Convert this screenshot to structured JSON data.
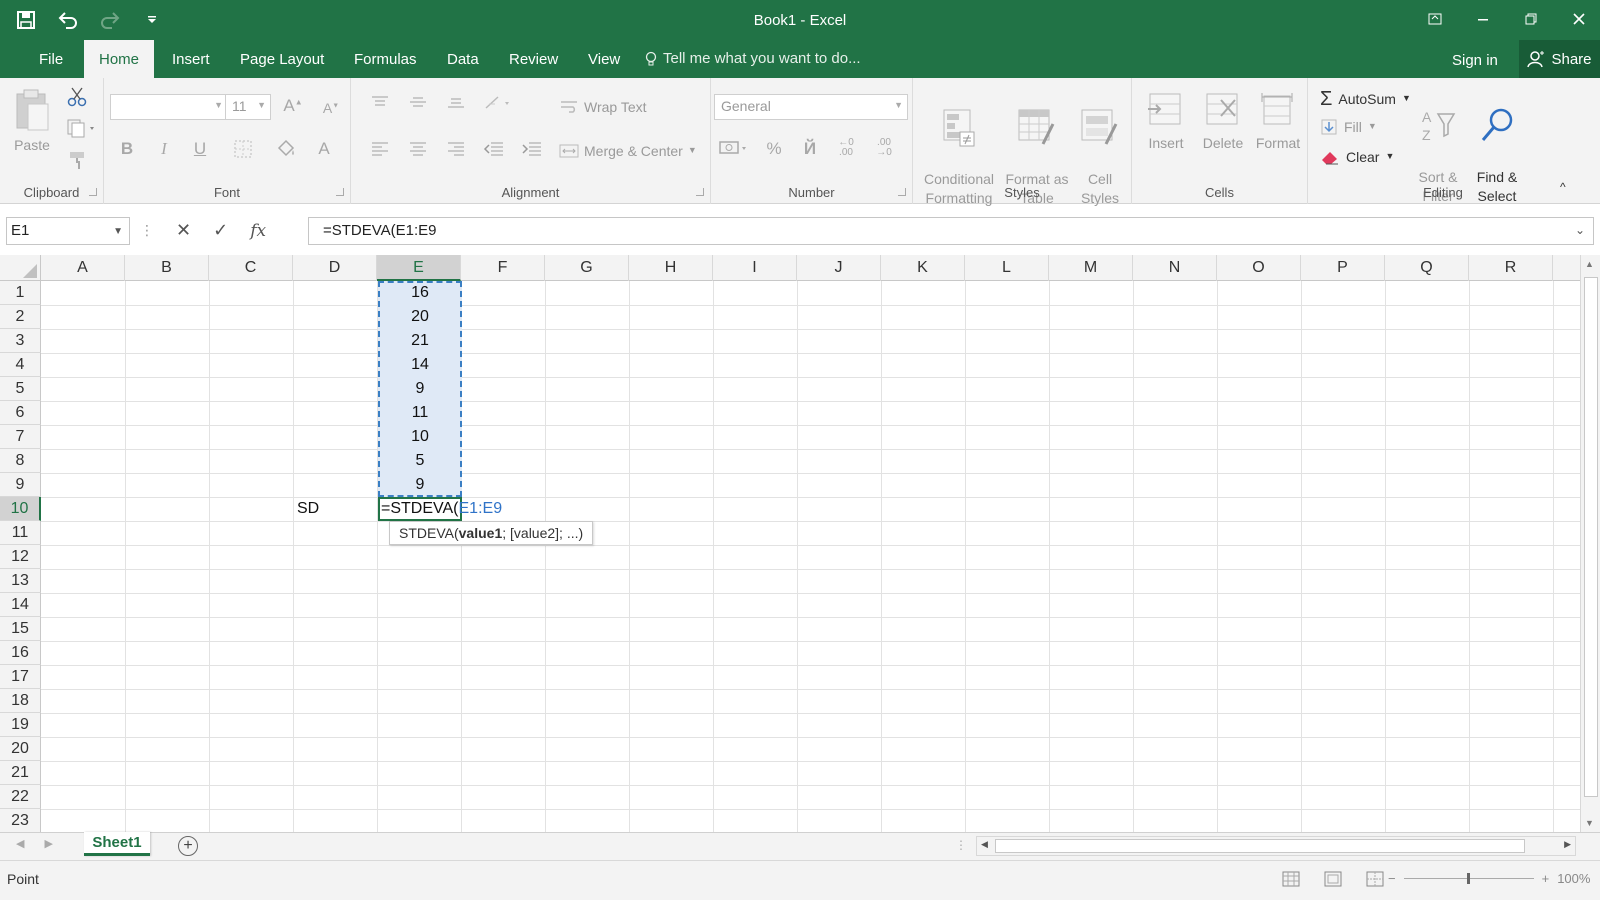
{
  "window": {
    "title": "Book1 - Excel"
  },
  "tabs": [
    "File",
    "Home",
    "Insert",
    "Page Layout",
    "Formulas",
    "Data",
    "Review",
    "View"
  ],
  "tell_me": "Tell me what you want to do...",
  "sign_in": "Sign in",
  "share": "Share",
  "ribbon": {
    "clipboard": {
      "label": "Clipboard",
      "paste": "Paste"
    },
    "font": {
      "label": "Font",
      "name": "",
      "size": "11",
      "bold": "B",
      "italic": "I",
      "underline": "U",
      "font_color": "A"
    },
    "alignment": {
      "label": "Alignment",
      "wrap_text": "Wrap Text",
      "merge_center": "Merge & Center"
    },
    "number": {
      "label": "Number",
      "format": "General",
      "percent": "%",
      "comma": "Й"
    },
    "styles": {
      "label": "Styles",
      "conditional": "Conditional\nFormatting",
      "format_table": "Format as\nTable",
      "cell_styles": "Cell\nStyles"
    },
    "cells": {
      "label": "Cells",
      "insert": "Insert",
      "delete": "Delete",
      "format": "Format"
    },
    "editing": {
      "label": "Editing",
      "autosum": "AutoSum",
      "fill": "Fill",
      "clear": "Clear",
      "sort_filter": "Sort &\nFilter",
      "find_select": "Find &\nSelect"
    }
  },
  "formula_bar": {
    "name_box": "E1",
    "formula": "=STDEVA(E1:E9"
  },
  "columns": [
    "A",
    "B",
    "C",
    "D",
    "E",
    "F",
    "G",
    "H",
    "I",
    "J",
    "K",
    "L",
    "M",
    "N",
    "O",
    "P",
    "Q",
    "R"
  ],
  "rows": [
    "1",
    "2",
    "3",
    "4",
    "5",
    "6",
    "7",
    "8",
    "9",
    "10",
    "11",
    "12",
    "13",
    "14",
    "15",
    "16",
    "17",
    "18",
    "19",
    "20",
    "21",
    "22",
    "23"
  ],
  "cells": {
    "E": [
      "16",
      "20",
      "21",
      "14",
      "9",
      "11",
      "10",
      "5",
      "9"
    ],
    "D10": "SD",
    "E10_prefix": "=STDEVA(",
    "E10_ref": "E1:E9"
  },
  "tooltip": {
    "fn": "STDEVA(",
    "arg1": "value1",
    "rest": "; [value2]; ...)"
  },
  "sheet_tab": "Sheet1",
  "status": {
    "mode": "Point",
    "zoom": "100%"
  },
  "colors": {
    "accent": "#217346",
    "selection": "#dfe9f6",
    "reference": "#2f73c8"
  }
}
